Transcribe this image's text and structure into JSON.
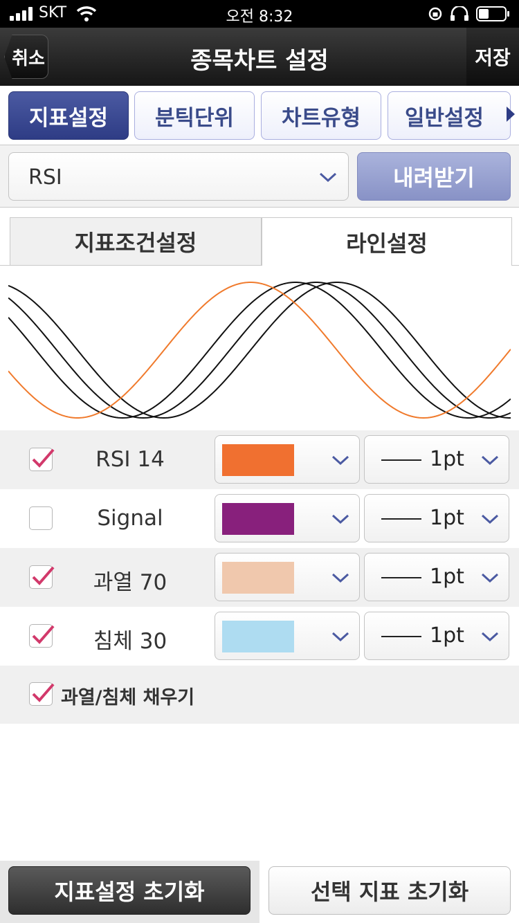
{
  "status_bar": {
    "carrier": "SKT",
    "time": "오전 8:32"
  },
  "nav": {
    "cancel_label": "취소",
    "title": "종목차트 설정",
    "save_label": "저장"
  },
  "top_tabs": [
    {
      "label": "지표설정",
      "active": true
    },
    {
      "label": "분틱단위",
      "active": false
    },
    {
      "label": "차트유형",
      "active": false
    },
    {
      "label": "일반설정",
      "active": false
    }
  ],
  "indicator": {
    "selected": "RSI",
    "download_label": "내려받기"
  },
  "sub_tabs": [
    {
      "label": "지표조건설정",
      "active": false
    },
    {
      "label": "라인설정",
      "active": true
    }
  ],
  "preview": {
    "colors": {
      "orange": "#f07a2c",
      "black": "#111111"
    }
  },
  "lines": [
    {
      "label": "RSI 14",
      "checked": true,
      "color": "#f07030",
      "width": "1pt"
    },
    {
      "label": "Signal",
      "checked": false,
      "color": "#88207c",
      "width": "1pt"
    },
    {
      "label": "과열 70",
      "checked": true,
      "color": "#f0c8ad",
      "width": "1pt"
    },
    {
      "label": "침체 30",
      "checked": true,
      "color": "#aedcf1",
      "width": "1pt"
    }
  ],
  "fill": {
    "label": "과열/침체 채우기",
    "checked": true
  },
  "bottom": {
    "reset_all_label": "지표설정 초기화",
    "reset_selected_label": "선택 지표 초기화"
  },
  "colors": {
    "accent": "#2e3c85",
    "check": "#d2396b"
  }
}
